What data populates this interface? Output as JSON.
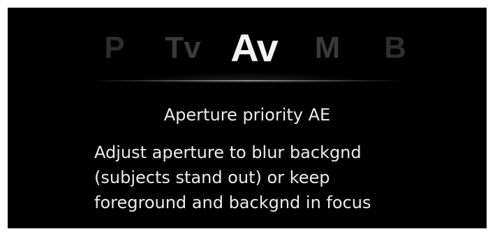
{
  "modes": {
    "p": "P",
    "tv": "Tv",
    "av": "Av",
    "m": "M",
    "b": "B",
    "selected": "Av"
  },
  "mode_name": "Aperture priority AE",
  "description": {
    "lines": [
      "Adjust aperture to blur backgnd",
      "(subjects stand out) or keep",
      "foreground and backgnd in focus"
    ]
  },
  "colors": {
    "background": "#000000",
    "selected_text": "#f2f2f2",
    "unselected_text": "#3a3a3a",
    "body_text": "#ececec"
  }
}
